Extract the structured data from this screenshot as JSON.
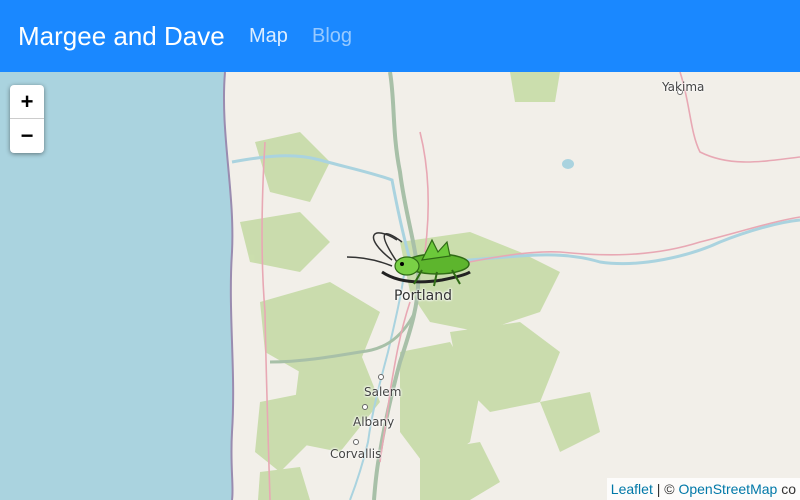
{
  "navbar": {
    "brand": "Margee and Dave",
    "links": [
      {
        "label": "Map"
      },
      {
        "label": "Blog"
      }
    ],
    "background": "#1a88ff"
  },
  "map": {
    "zoom_in_label": "+",
    "zoom_out_label": "−",
    "places": [
      {
        "name": "Portland"
      },
      {
        "name": "Salem"
      },
      {
        "name": "Albany"
      },
      {
        "name": "Corvallis"
      },
      {
        "name": "Yakima"
      }
    ],
    "marker_icon": "grasshopper-icon",
    "attribution": {
      "leaflet": "Leaflet",
      "separator": " | © ",
      "osm": "OpenStreetMap",
      "suffix": " co"
    },
    "colors": {
      "ocean": "#aad3df",
      "land": "#f2efe9",
      "forest": "#c8dcaa",
      "motorway": "#a8c0a8",
      "primary": "#e8b0b8",
      "border": "#b0a0c0"
    }
  }
}
